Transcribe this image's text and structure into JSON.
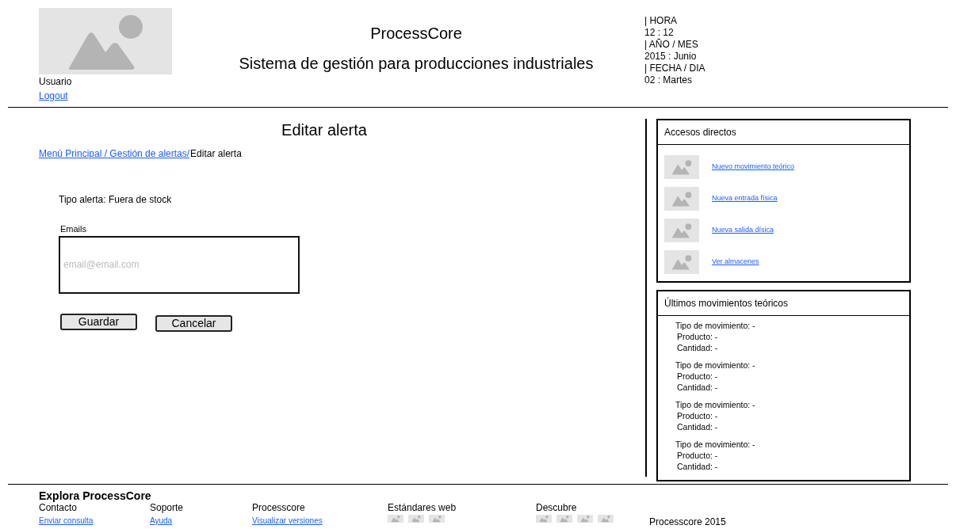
{
  "header": {
    "user_label": "Usuario",
    "logout_link": "Logout",
    "app_name": "ProcessCore",
    "subtitle": "Sistema de gestión para producciones industriales",
    "clock": [
      "| HORA",
      "12 : 12",
      "| AÑO / MES",
      "2015 : Junio",
      "| FECHA / DIA",
      "02 : Martes"
    ]
  },
  "main": {
    "title": "Editar alerta",
    "breadcrumb_link": "Menú Principal / Gestión de alertas/",
    "breadcrumb_current": "Editar alerta",
    "alert_type": "Tipo alerta: Fuera de stock",
    "emails_label": "Emails",
    "emails_placeholder": "email@email.com",
    "buttons": [
      "Guardar",
      "Cancelar"
    ]
  },
  "shortcuts": {
    "title": "Accesos directos",
    "items": [
      {
        "label": "Nuevo movimiento teórico"
      },
      {
        "label": "Nueva entrada física"
      },
      {
        "label": "Nueva salida dísica"
      },
      {
        "label": "Ver almacenes"
      }
    ]
  },
  "recent": {
    "title": "Últimos movimientos teóricos",
    "items": [
      {
        "lines": [
          "Tipo de movimiento: -",
          "Producto: -",
          "Cantidad: -"
        ]
      },
      {
        "lines": [
          "Tipo de movimiento: -",
          "Producto: -",
          "Cantidad: -"
        ]
      },
      {
        "lines": [
          "Tipo de movimiento: -",
          "Producto: -",
          "Cantidad: -"
        ]
      },
      {
        "lines": [
          "Tipo de movimiento: -",
          "Producto: -",
          "Cantidad: -"
        ]
      }
    ]
  },
  "footer": {
    "title": "Explora ProcessCore",
    "columns": [
      {
        "heading": "Contacto",
        "link": "Enviar consulta"
      },
      {
        "heading": "Soporte",
        "link": "Ayuda"
      },
      {
        "heading": "Processcore",
        "link": "Visualizar versiones"
      },
      {
        "heading": "Estándares web"
      },
      {
        "heading": "Descubre"
      }
    ],
    "copyright": "Processcore 2015"
  }
}
